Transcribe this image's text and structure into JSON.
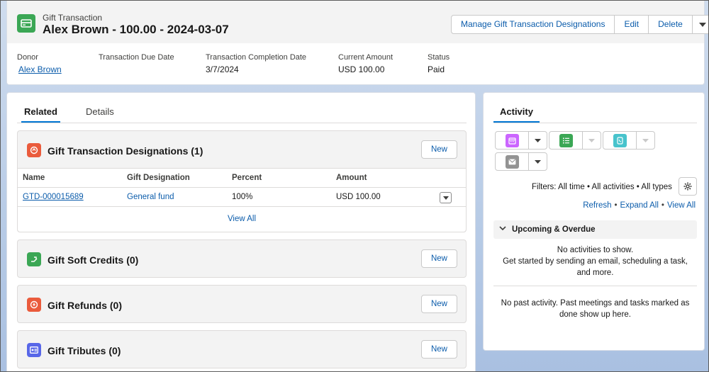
{
  "header": {
    "record_type": "Gift Transaction",
    "title": "Alex Brown - 100.00 - 2024-03-07",
    "actions": [
      "Manage Gift Transaction Designations",
      "Edit",
      "Delete"
    ],
    "fields": [
      {
        "label": "Donor",
        "value": "Alex Brown"
      },
      {
        "label": "Transaction Due Date",
        "value": ""
      },
      {
        "label": "Transaction Completion Date",
        "value": "3/7/2024"
      },
      {
        "label": "Current Amount",
        "value": "USD 100.00"
      },
      {
        "label": "Status",
        "value": "Paid"
      }
    ]
  },
  "tabs": [
    "Related",
    "Details"
  ],
  "designations": {
    "title": "Gift Transaction Designations (1)",
    "new_label": "New",
    "columns": [
      "Name",
      "Gift Designation",
      "Percent",
      "Amount"
    ],
    "rows": [
      {
        "name": "GTD-000015689",
        "designation": "General fund",
        "percent": "100%",
        "amount": "USD 100.00"
      }
    ],
    "view_all": "View All"
  },
  "soft_credits": {
    "title": "Gift Soft Credits (0)",
    "new_label": "New"
  },
  "refunds": {
    "title": "Gift Refunds (0)",
    "new_label": "New"
  },
  "tributes": {
    "title": "Gift Tributes (0)",
    "new_label": "New"
  },
  "activity": {
    "tab": "Activity",
    "filters": "Filters: All time • All activities • All types",
    "links": [
      "Refresh",
      "Expand All",
      "View All"
    ],
    "upcoming_title": "Upcoming & Overdue",
    "no_activities": "No activities to show.",
    "get_started": "Get started by sending an email, scheduling a task, and more.",
    "no_past": "No past activity. Past meetings and tasks marked as done show up here."
  },
  "colors": {
    "brand_blue": "#0176d3",
    "link_blue": "#0b5cab",
    "gift_green": "#3ba755",
    "designation_orange": "#ea5b3c",
    "tribute_purple": "#5867e8",
    "event_pink": "#cb65ff",
    "call_teal": "#48c3cc",
    "email_gray": "#939393"
  }
}
